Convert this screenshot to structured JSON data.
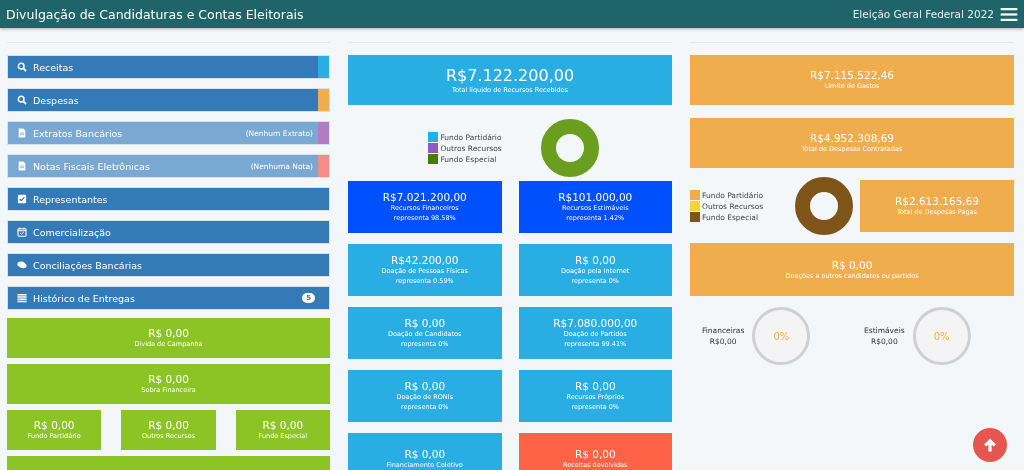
{
  "header": {
    "title": "Divulgação de Candidaturas e Contas Eleitorais",
    "election": "Eleição Geral Federal 2022"
  },
  "accounts": {
    "items": [
      {
        "label": "Receitas",
        "kind": "search",
        "color": "#29aee4"
      },
      {
        "label": "Despesas",
        "kind": "search",
        "color": "#f0ad4e"
      },
      {
        "label": "Extratos Bancários",
        "note": "(Nenhum Extrato)",
        "kind": "document",
        "color": "#b27cc1"
      },
      {
        "label": "Notas Fiscais Eletrônicas",
        "note": "(Nenhuma Nota)",
        "kind": "document",
        "color": "#f28e86"
      },
      {
        "label": "Representantes",
        "kind": "check"
      },
      {
        "label": "Comercialização",
        "kind": "calendar"
      },
      {
        "label": "Conciliações Bancárias",
        "kind": "chat"
      },
      {
        "label": "Histórico de Entregas",
        "kind": "list",
        "badge": "5"
      }
    ],
    "cards": [
      {
        "value": "R$ 0,00",
        "label": "Divida de Campanha",
        "kind": "wide"
      },
      {
        "value": "R$ 0,00",
        "label": "Sobra Financeira",
        "kind": "wide"
      },
      {
        "value": "R$ 0,00",
        "label": "Fundo Partidário",
        "kind": "third"
      },
      {
        "value": "R$ 0,00",
        "label": "Outros Recursos",
        "kind": "third"
      },
      {
        "value": "R$ 0,00",
        "label": "Fundo Especial",
        "kind": "third"
      },
      {
        "kind": "wide"
      }
    ]
  },
  "receitas": {
    "total": {
      "value": "R$7.122.200,00",
      "label": "Total líquido de Recursos Recebidos"
    },
    "legend": [
      {
        "label": "Fundo Partidário",
        "color": "#29aee4"
      },
      {
        "label": "Outros Recursos",
        "color": "#8e5bc4"
      },
      {
        "label": "Fundo Especial",
        "color": "#4a7a00"
      }
    ],
    "cards": [
      {
        "value": "R$7.021.200,00",
        "label": "Recursos Financeiros",
        "share": "representa 98.58%",
        "kind": "summary"
      },
      {
        "value": "R$101.000,00",
        "label": "Recursos Estimáveis",
        "share": "representa 1.42%",
        "kind": "summary"
      },
      {
        "value": "R$42.200,00",
        "label": "Doação de Pessoas Físicas",
        "share": "representa 0.59%",
        "kind": "detail"
      },
      {
        "value": "R$ 0,00",
        "label": "Doação pela Internet",
        "share": "representa 0%",
        "kind": "detail"
      },
      {
        "value": "R$ 0,00",
        "label": "Doação de Candidatos",
        "share": "representa 0%",
        "kind": "detail"
      },
      {
        "value": "R$7.080.000,00",
        "label": "Doação de Partidos",
        "share": "representa 99.41%",
        "kind": "detail"
      },
      {
        "value": "R$ 0,00",
        "label": "Doação de RONIs",
        "share": "representa 0%",
        "kind": "detail"
      },
      {
        "value": "R$ 0,00",
        "label": "Recursos Próprios",
        "share": "representa 0%",
        "kind": "detail"
      },
      {
        "value": "R$ 0,00",
        "label": "Financiamento Coletivo",
        "kind": "detail"
      },
      {
        "value": "R$ 0,00",
        "label": "Receitas devolvidas",
        "kind": "returned"
      }
    ]
  },
  "despesas": {
    "cards": [
      {
        "value": "R$7.115.522,46",
        "label": "Limite de Gastos"
      },
      {
        "value": "R$4.952.308,69",
        "label": "Total de Despesas Contratadas"
      }
    ],
    "legend": [
      {
        "label": "Fundo Partidário",
        "color": "#f0ad4e"
      },
      {
        "label": "Outros Recursos",
        "color": "#f0d43a"
      },
      {
        "label": "Fundo Especial",
        "color": "#7f5418"
      }
    ],
    "paid": {
      "value": "R$2.613.165,69",
      "label": "Total de Despesas Pagas"
    },
    "donations": {
      "value": "R$ 0,00",
      "label": "Doações a outros candidatos ou partidos"
    },
    "gauges": [
      {
        "label": "Financeiras",
        "value": "R$0,00",
        "percent": "0%"
      },
      {
        "label": "Estimáveis",
        "value": "R$0,00",
        "percent": "0%"
      }
    ]
  }
}
